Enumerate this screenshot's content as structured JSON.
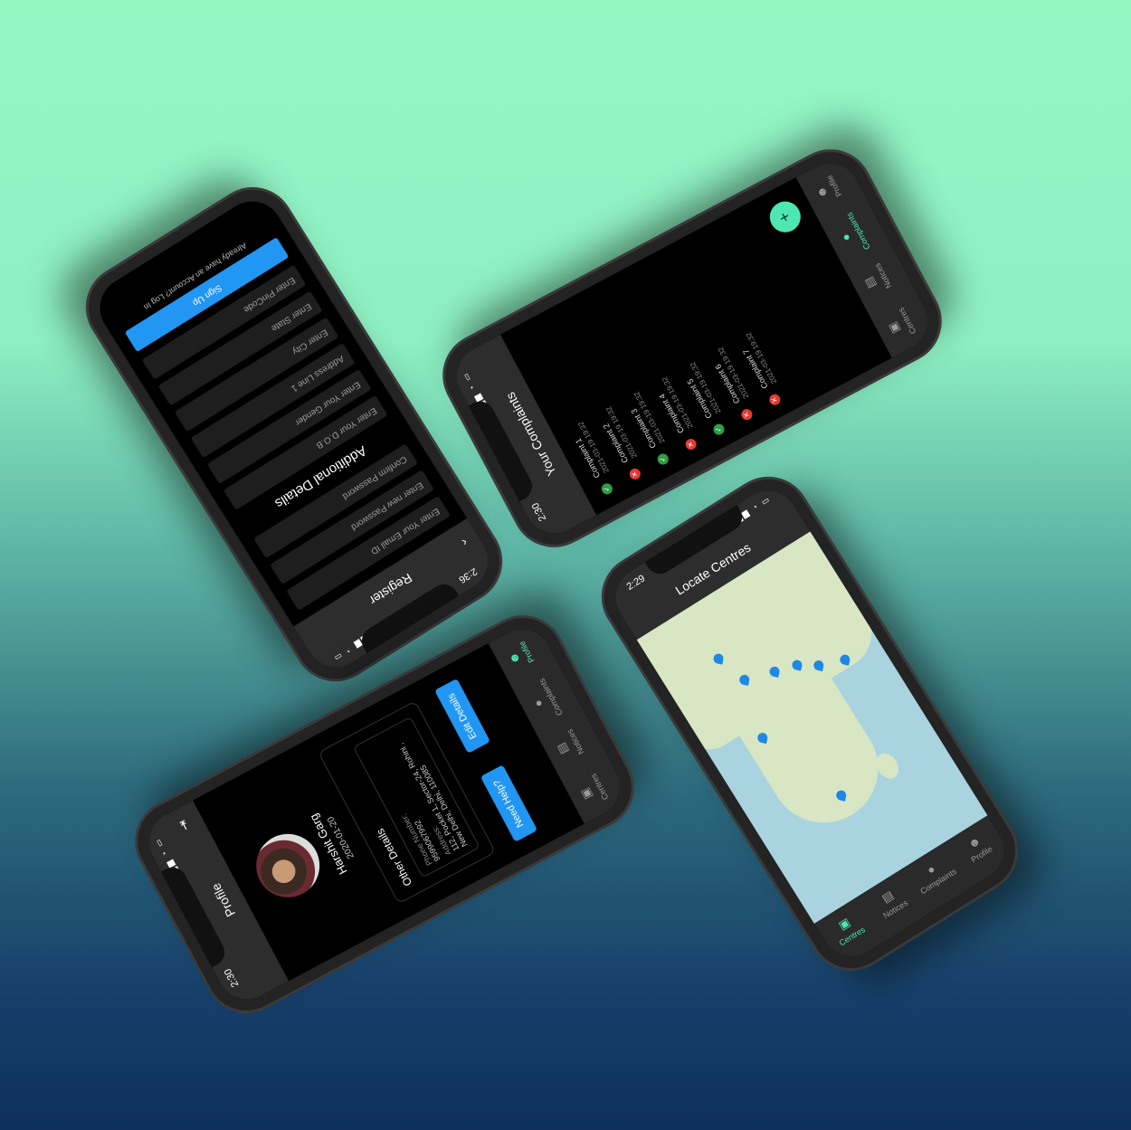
{
  "register": {
    "time": "2:36",
    "title": "Register",
    "fields": [
      "Enter Your Email ID",
      "Enter new Password",
      "Confirm Password"
    ],
    "section": "Additional Details",
    "fields2": [
      "Enter Your D.O.B",
      "Enter Your Gender",
      "Address Line 1",
      "Enter City",
      "Enter State",
      "Enter PinCode"
    ],
    "signup": "Sign Up",
    "login": "Already have an Account? Log In"
  },
  "complaints": {
    "time": "2:30",
    "title": "Your Complaints",
    "fab": "+",
    "items": [
      {
        "title": "Complaint 1",
        "sub": "2021-03-19 19:32",
        "status": "done"
      },
      {
        "title": "Complaint 2",
        "sub": "2021-03-19 19:32",
        "status": "pending"
      },
      {
        "title": "Complaint 3",
        "sub": "2021-03-19 19:32",
        "status": "done"
      },
      {
        "title": "Complaint 4",
        "sub": "2021-03-19 19:32",
        "status": "pending"
      },
      {
        "title": "Complaint 5",
        "sub": "2021-03-19 19:32",
        "status": "done"
      },
      {
        "title": "Complaint 6",
        "sub": "2021-03-19 19:32",
        "status": "pending"
      },
      {
        "title": "Complaint 7",
        "sub": "2021-03-19 19:32",
        "status": "pending"
      }
    ],
    "nav": [
      "Centres",
      "Notices",
      "Complaints",
      "Profile"
    ]
  },
  "centres": {
    "time": "2:29",
    "title": "Locate Centres",
    "nav": [
      "Centres",
      "Notices",
      "Complaints",
      "Profile"
    ]
  },
  "profile": {
    "time": "2:30",
    "title": "Profile",
    "name": "Harshit Garg",
    "dob": "2020-01-20",
    "section": "Other Details",
    "phone_label": "Phone Number:",
    "phone": "9599067992",
    "address_label": "Address:",
    "address": "112, Pocket 1, Sector-24, Rohini , New Delhi, Delhi, 110085",
    "help": "Need Help?",
    "edit": "Edit Details",
    "nav": [
      "Centres",
      "Notices",
      "Complaints",
      "Profile"
    ]
  },
  "colors": {
    "accent": "#4fe7b1",
    "blue": "#2196f3",
    "done": "#2e9e44",
    "pending": "#e53935"
  }
}
